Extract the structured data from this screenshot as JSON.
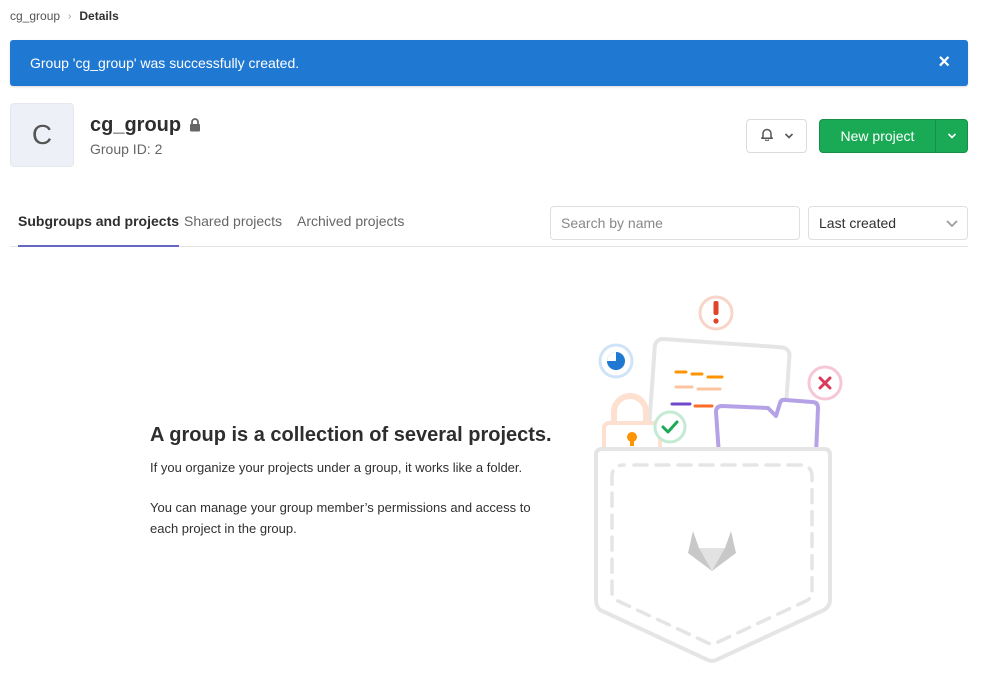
{
  "breadcrumb": {
    "group": "cg_group",
    "current": "Details"
  },
  "flash": {
    "message": "Group 'cg_group' was successfully created.",
    "close": "×",
    "color": "#1f78d1"
  },
  "group": {
    "avatar_letter": "C",
    "name": "cg_group",
    "id_text": "Group ID: 2"
  },
  "actions": {
    "new_project": "New project",
    "primary_color": "#1aaa55"
  },
  "tabs": [
    {
      "label": "Subgroups and projects",
      "active": true
    },
    {
      "label": "Shared projects",
      "active": false
    },
    {
      "label": "Archived projects",
      "active": false
    }
  ],
  "search": {
    "placeholder": "Search by name"
  },
  "sort": {
    "selected": "Last created"
  },
  "empty_state": {
    "title": "A group is a collection of several projects.",
    "line1": "If you organize your projects under a group, it works like a folder.",
    "line2": "You can manage your group member’s permissions and access to each project in the group."
  },
  "icons": [
    "chevron-right-icon",
    "close-icon",
    "lock-icon",
    "bell-icon",
    "chevron-down-icon"
  ]
}
